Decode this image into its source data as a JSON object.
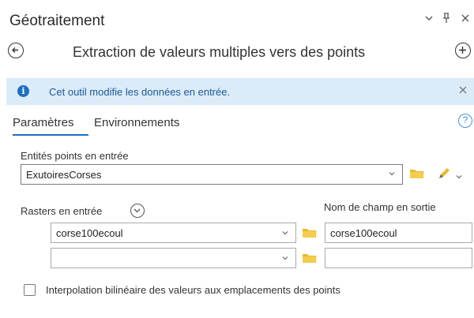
{
  "pane": {
    "title": "Géotraitement",
    "controls": [
      "chevron-down-icon",
      "pin-icon",
      "close-icon"
    ]
  },
  "tool": {
    "title": "Extraction de valeurs multiples vers des points"
  },
  "banner": {
    "text": "Cet outil modifie les données en entrée.",
    "color": "#dcebf8"
  },
  "tabs": [
    {
      "label": "Paramètres",
      "active": true
    },
    {
      "label": "Environnements",
      "active": false
    }
  ],
  "params": {
    "input_points_label": "Entités points en entrée",
    "input_points_value": "ExutoiresCorses",
    "rasters_label": "Rasters en entrée",
    "output_field_label": "Nom de champ en sortie",
    "rows": [
      {
        "raster": "corse100ecoul",
        "field_name": "corse100ecoul"
      },
      {
        "raster": "",
        "field_name": ""
      }
    ],
    "interp_label": "Interpolation bilinéaire des valeurs aux emplacements des points",
    "interp_checked": false
  },
  "colors": {
    "accent": "#1f6fc0",
    "folder": "#e8b92b"
  }
}
